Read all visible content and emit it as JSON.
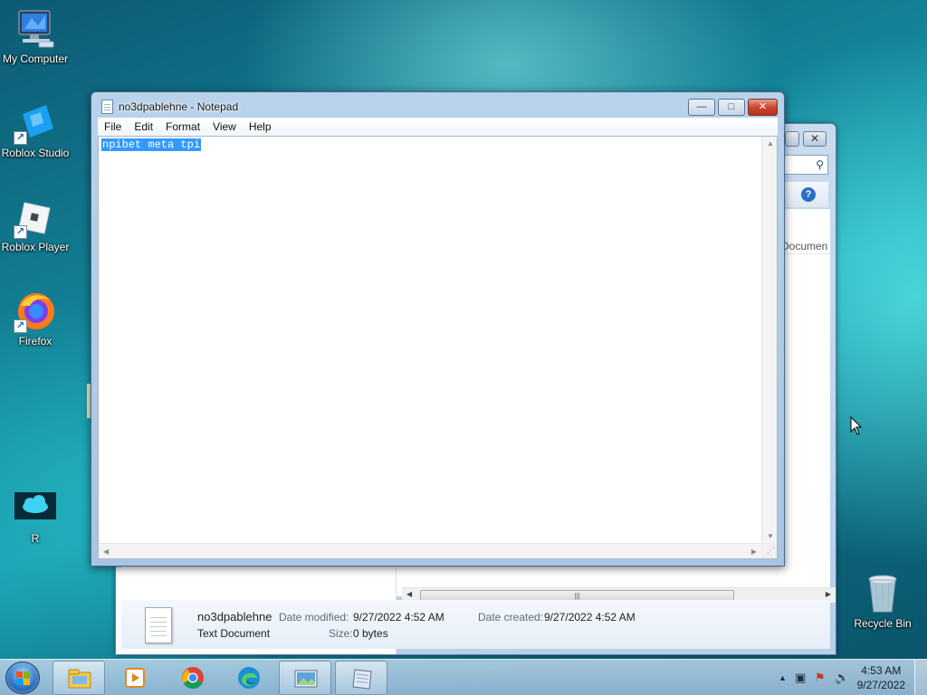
{
  "desktop": {
    "icons": [
      {
        "label": "My Computer"
      },
      {
        "label": "Roblox Studio"
      },
      {
        "label": "Roblox Player"
      },
      {
        "label": "Firefox"
      },
      {
        "label": "R"
      },
      {
        "label": "Recycle Bin"
      }
    ]
  },
  "notepad": {
    "title": "no3dpablehne - Notepad",
    "menu": [
      "File",
      "Edit",
      "Format",
      "View",
      "Help"
    ],
    "content": "npibet meta tpi",
    "selection": "all"
  },
  "explorer": {
    "column_header_partial": "Documen",
    "details": {
      "file_name": "no3dpablehne",
      "file_type": "Text Document",
      "date_modified_label": "Date modified:",
      "date_modified": "9/27/2022 4:52 AM",
      "size_label": "Size:",
      "size": "0 bytes",
      "date_created_label": "Date created:",
      "date_created": "9/27/2022 4:52 AM"
    }
  },
  "taskbar": {
    "pinned": [
      {
        "icon": "windows-explorer-icon"
      },
      {
        "icon": "media-player-icon"
      },
      {
        "icon": "chrome-icon"
      },
      {
        "icon": "edge-icon"
      },
      {
        "icon": "explorer-window-icon",
        "active": true
      },
      {
        "icon": "notepad-icon",
        "active": true
      }
    ],
    "clock": {
      "time": "4:53 AM",
      "date": "9/27/2022"
    }
  },
  "colors": {
    "selection": "#3399ff",
    "close_button": "#c9462f",
    "window_frame": "#b9d2ec"
  }
}
